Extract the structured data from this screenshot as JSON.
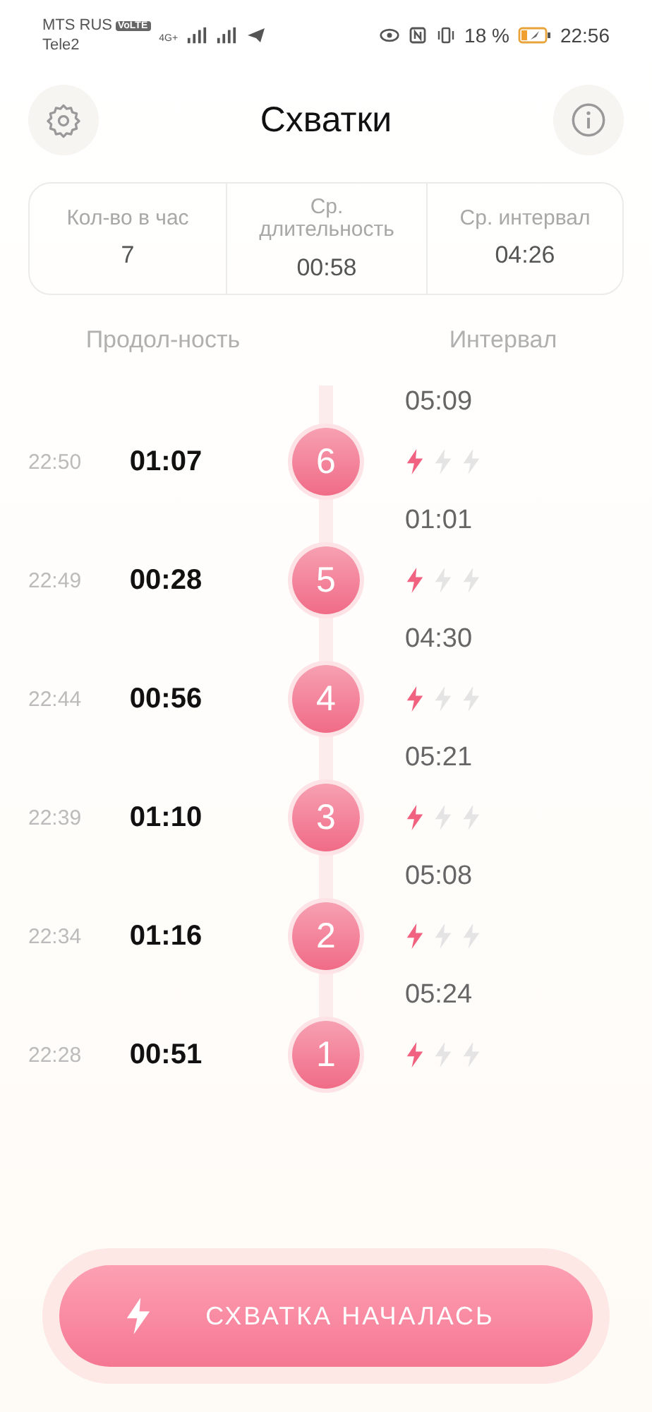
{
  "status_bar": {
    "carrier_1": "MTS RUS",
    "volte": "VoLTE",
    "network": "4G+",
    "carrier_2": "Tele2",
    "battery": "18 %",
    "time": "22:56"
  },
  "header": {
    "title": "Схватки"
  },
  "stats": [
    {
      "label": "Кол-во в час",
      "value": "7"
    },
    {
      "label": "Ср. длительность",
      "value": "00:58"
    },
    {
      "label": "Ср. интервал",
      "value": "04:26"
    }
  ],
  "columns": {
    "duration": "Продол-ность",
    "interval": "Интервал"
  },
  "contractions": [
    {
      "interval": "05:09",
      "time": "22:50",
      "duration": "01:07",
      "number": "6",
      "stars": 1
    },
    {
      "interval": "01:01",
      "time": "22:49",
      "duration": "00:28",
      "number": "5",
      "stars": 1
    },
    {
      "interval": "04:30",
      "time": "22:44",
      "duration": "00:56",
      "number": "4",
      "stars": 1
    },
    {
      "interval": "05:21",
      "time": "22:39",
      "duration": "01:10",
      "number": "3",
      "stars": 1
    },
    {
      "interval": "05:08",
      "time": "22:34",
      "duration": "01:16",
      "number": "2",
      "stars": 1
    },
    {
      "interval": "05:24",
      "time": "22:28",
      "duration": "00:51",
      "number": "1",
      "stars": 1
    }
  ],
  "start_button": {
    "label": "СХВАТКА НАЧАЛАСЬ"
  }
}
